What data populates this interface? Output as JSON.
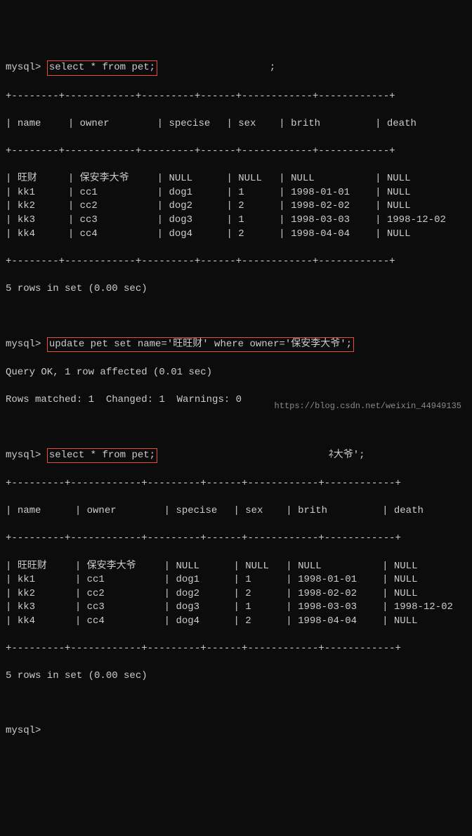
{
  "prompt": "mysql>",
  "queries": {
    "select1": "select * from pet;",
    "update": "update pet set name='旺旺财' where owner='保安李大爷';",
    "select2": "select * from pet;"
  },
  "extra_semicolon": ";",
  "extra_text": "ﾈ大爷';",
  "update_result": {
    "line1": "Query OK, 1 row affected (0.01 sec)",
    "line2": "Rows matched: 1  Changed: 1  Warnings: 0"
  },
  "rows_msg": "5 rows in set (0.00 sec)",
  "sep1": "+--------+------------+---------+------+------------+------------+",
  "sep2": "+---------+------------+---------+------+------------+------------+",
  "headers": {
    "name": "name",
    "owner": "owner",
    "specise": "specise",
    "sex": "sex",
    "brith": "brith",
    "death": "death"
  },
  "table1": [
    {
      "name": "旺财",
      "owner": "保安李大爷",
      "specise": "NULL",
      "sex": "NULL",
      "brith": "NULL",
      "death": "NULL"
    },
    {
      "name": "kk1",
      "owner": "cc1",
      "specise": "dog1",
      "sex": "1",
      "brith": "1998-01-01",
      "death": "NULL"
    },
    {
      "name": "kk2",
      "owner": "cc2",
      "specise": "dog2",
      "sex": "2",
      "brith": "1998-02-02",
      "death": "NULL"
    },
    {
      "name": "kk3",
      "owner": "cc3",
      "specise": "dog3",
      "sex": "1",
      "brith": "1998-03-03",
      "death": "1998-12-02"
    },
    {
      "name": "kk4",
      "owner": "cc4",
      "specise": "dog4",
      "sex": "2",
      "brith": "1998-04-04",
      "death": "NULL"
    }
  ],
  "table2": [
    {
      "name": "旺旺财",
      "owner": "保安李大爷",
      "specise": "NULL",
      "sex": "NULL",
      "brith": "NULL",
      "death": "NULL"
    },
    {
      "name": "kk1",
      "owner": "cc1",
      "specise": "dog1",
      "sex": "1",
      "brith": "1998-01-01",
      "death": "NULL"
    },
    {
      "name": "kk2",
      "owner": "cc2",
      "specise": "dog2",
      "sex": "2",
      "brith": "1998-02-02",
      "death": "NULL"
    },
    {
      "name": "kk3",
      "owner": "cc3",
      "specise": "dog3",
      "sex": "1",
      "brith": "1998-03-03",
      "death": "1998-12-02"
    },
    {
      "name": "kk4",
      "owner": "cc4",
      "specise": "dog4",
      "sex": "2",
      "brith": "1998-04-04",
      "death": "NULL"
    }
  ],
  "watermark": "https://blog.csdn.net/weixin_44949135",
  "chart_data": {
    "type": "table",
    "before": {
      "columns": [
        "name",
        "owner",
        "specise",
        "sex",
        "brith",
        "death"
      ],
      "rows": [
        [
          "旺财",
          "保安李大爷",
          "NULL",
          "NULL",
          "NULL",
          "NULL"
        ],
        [
          "kk1",
          "cc1",
          "dog1",
          "1",
          "1998-01-01",
          "NULL"
        ],
        [
          "kk2",
          "cc2",
          "dog2",
          "2",
          "1998-02-02",
          "NULL"
        ],
        [
          "kk3",
          "cc3",
          "dog3",
          "1",
          "1998-03-03",
          "1998-12-02"
        ],
        [
          "kk4",
          "cc4",
          "dog4",
          "2",
          "1998-04-04",
          "NULL"
        ]
      ]
    },
    "after": {
      "columns": [
        "name",
        "owner",
        "specise",
        "sex",
        "brith",
        "death"
      ],
      "rows": [
        [
          "旺旺财",
          "保安李大爷",
          "NULL",
          "NULL",
          "NULL",
          "NULL"
        ],
        [
          "kk1",
          "cc1",
          "dog1",
          "1",
          "1998-01-01",
          "NULL"
        ],
        [
          "kk2",
          "cc2",
          "dog2",
          "2",
          "1998-02-02",
          "NULL"
        ],
        [
          "kk3",
          "cc3",
          "dog3",
          "1",
          "1998-03-03",
          "1998-12-02"
        ],
        [
          "kk4",
          "cc4",
          "dog4",
          "2",
          "1998-04-04",
          "NULL"
        ]
      ]
    }
  }
}
